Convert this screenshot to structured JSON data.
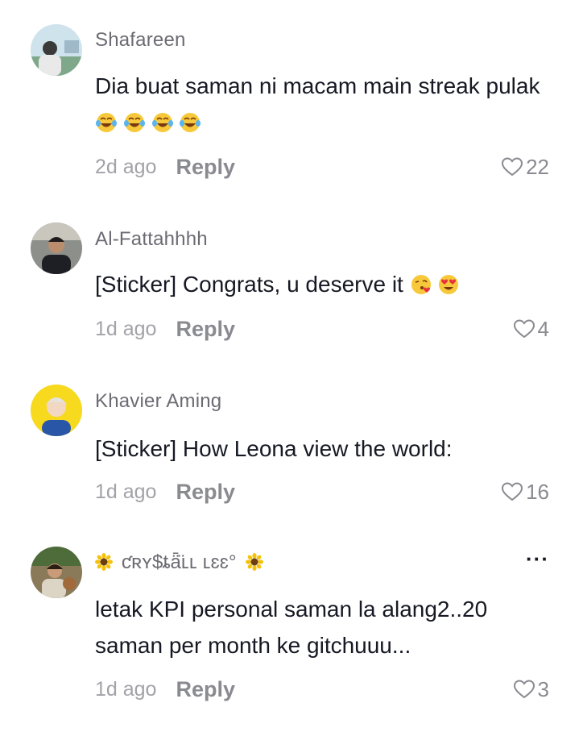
{
  "comments": [
    {
      "username": "Shafareen",
      "text": "Dia buat saman ni macam main streak pulak",
      "emojis": [
        "laughing-tears-emoji",
        "laughing-tears-emoji",
        "laughing-tears-emoji",
        "laughing-tears-emoji"
      ],
      "time": "2d ago",
      "reply_label": "Reply",
      "likes": "22"
    },
    {
      "username": "Al-Fattahhhh",
      "text": "[Sticker] Congrats, u deserve it",
      "emojis": [
        "kiss-emoji",
        "heart-eyes-emoji"
      ],
      "time": "1d ago",
      "reply_label": "Reply",
      "likes": "4"
    },
    {
      "username": "Khavier Aming",
      "text": "[Sticker] How Leona view the world:",
      "time": "1d ago",
      "reply_label": "Reply",
      "likes": "16"
    },
    {
      "username": "ƈʀʏ$ȶǟ̈ʟʟ ʟɛɛ°",
      "username_decor": "sunflower-emoji",
      "text_line1": "letak KPI personal saman la alang2..20",
      "text_line2": "saman per month ke gitchuuu...",
      "more_label": "···",
      "time": "1d ago",
      "reply_label": "Reply",
      "likes": "3"
    }
  ],
  "colors": {
    "text": "#161823",
    "username": "#6b6b73",
    "muted": "#a2a2a8",
    "reply": "#8a8a91"
  }
}
